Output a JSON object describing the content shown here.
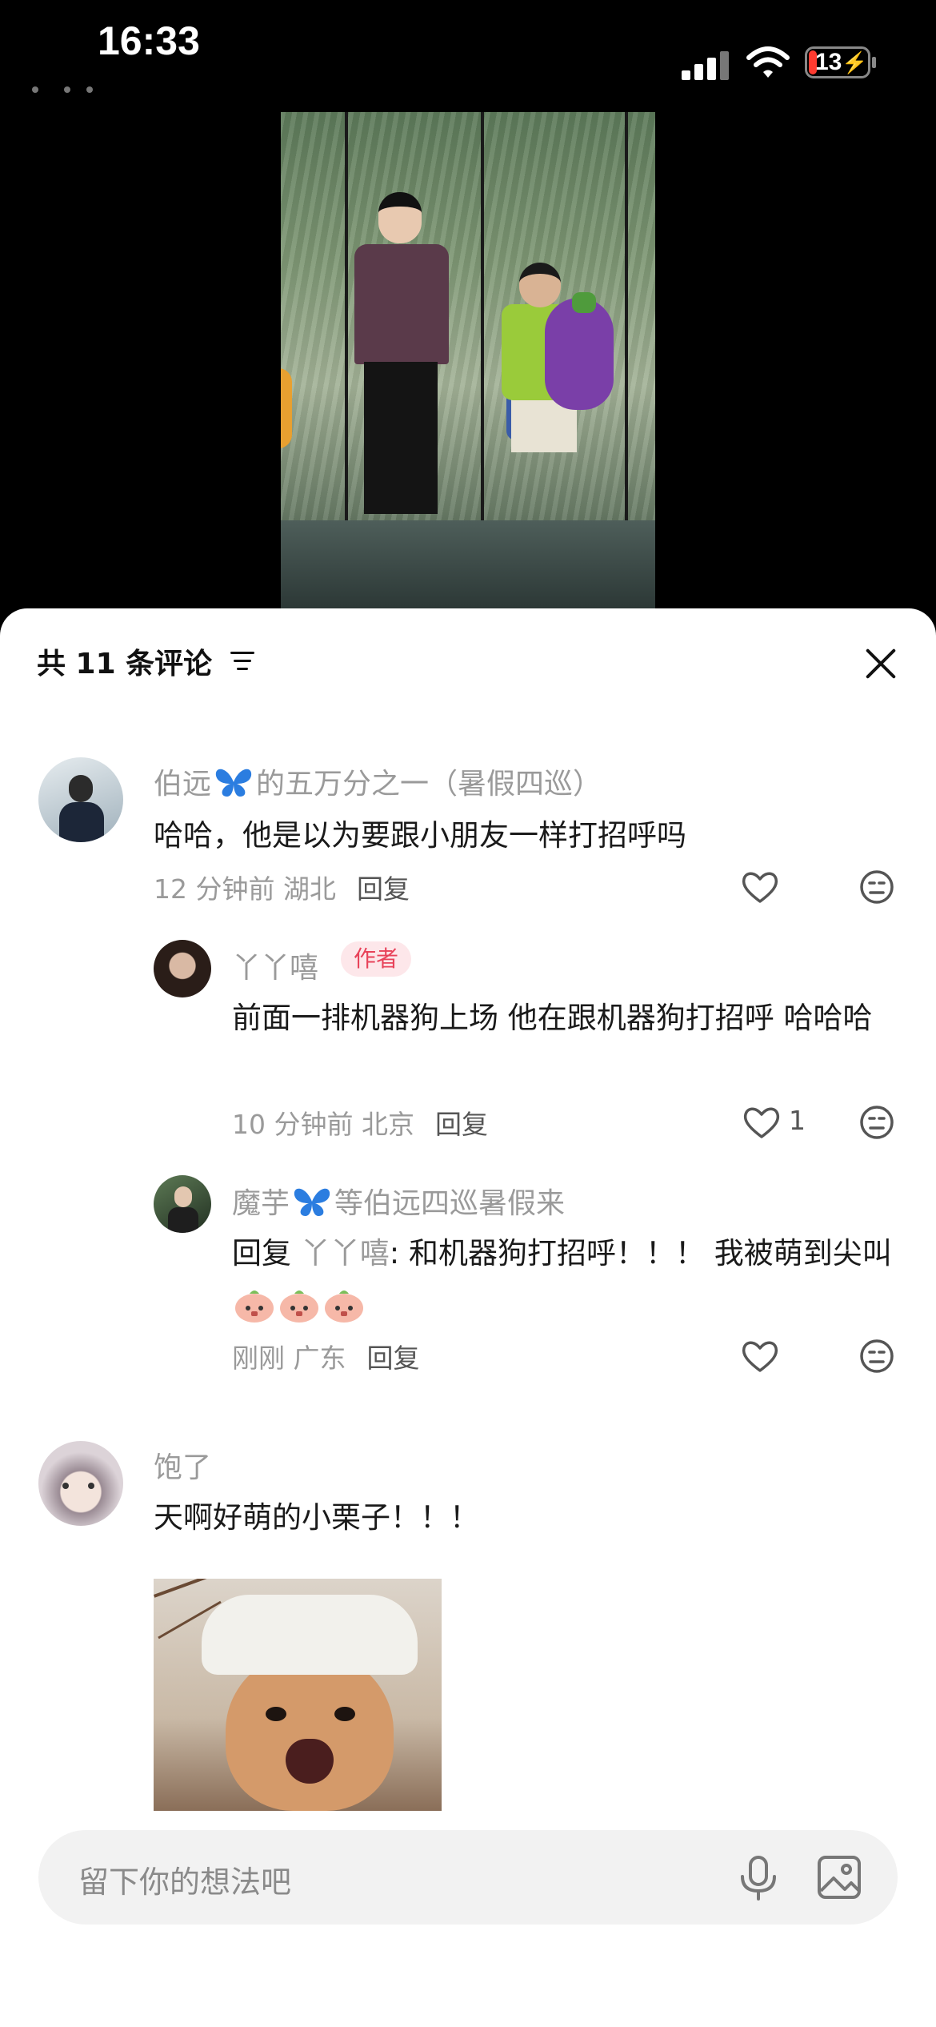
{
  "status_bar": {
    "time": "16:33",
    "battery": "13",
    "icons": [
      "signal-icon",
      "wifi-icon",
      "battery-charging-icon"
    ]
  },
  "video": {
    "description_icons": [
      "stage-scene"
    ]
  },
  "sheet": {
    "title": "共 11 条评论",
    "filter_icon": "filter-icon",
    "close_icon": "close-icon"
  },
  "comments": [
    {
      "username_before": "伯远",
      "username_after": "的五万分之一（暑假四巡）",
      "text": "哈哈，他是以为要跟小朋友一样打招呼吗",
      "time": "12 分钟前",
      "location": "湖北",
      "reply_label": "回复",
      "likes": ""
    },
    {
      "username": "丫丫嘻",
      "badge": "作者",
      "text": "前面一排机器狗上场 他在跟机器狗打招呼 哈哈哈",
      "time": "10 分钟前",
      "location": "北京",
      "reply_label": "回复",
      "likes": "1"
    },
    {
      "username_before": "魔芋",
      "username_after": "等伯远四巡暑假来",
      "reply_prefix": "回复 ",
      "reply_to": "丫丫嘻",
      "text": ": 和机器狗打招呼！！！ 我被萌到尖叫",
      "time": "刚刚",
      "location": "广东",
      "reply_label": "回复",
      "likes": ""
    },
    {
      "username": "饱了",
      "text": "天啊好萌的小栗子！！！",
      "sticker": "cat-chef-hat-sticker",
      "likes": ""
    }
  ],
  "input": {
    "placeholder": "留下你的想法吧",
    "icons": [
      "mic-icon",
      "image-icon"
    ]
  },
  "colors": {
    "accent_badge_bg": "#fde7ea",
    "accent_badge_text": "#e8435a",
    "muted_text": "#9a9a9a",
    "butterfly": "#2b7de0"
  }
}
